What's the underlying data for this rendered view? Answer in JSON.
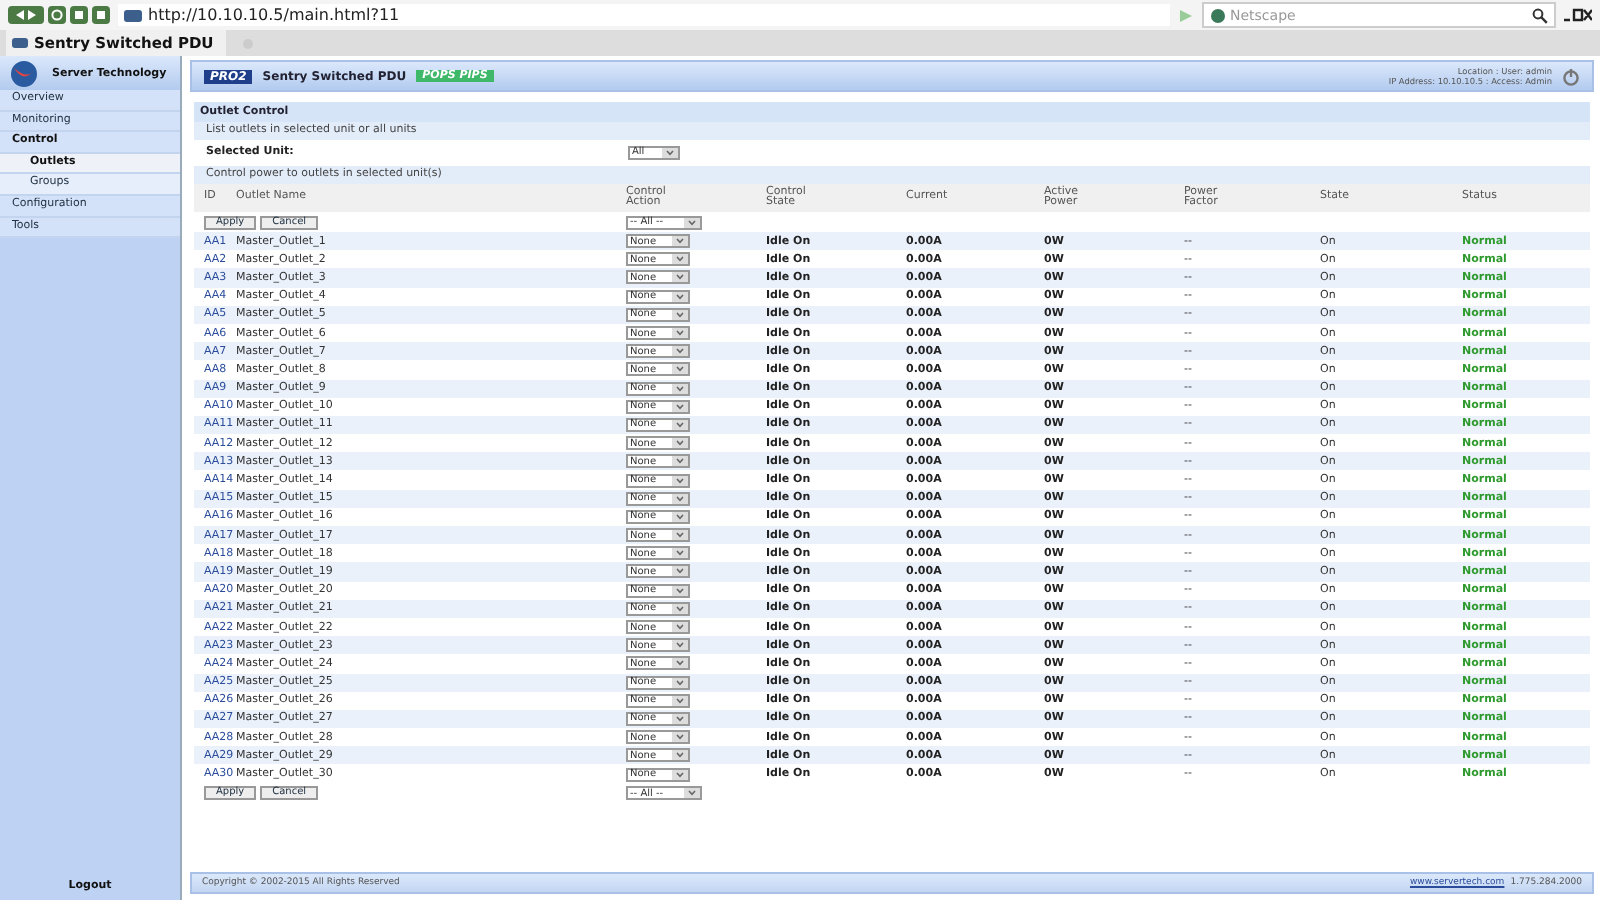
{
  "browser": {
    "url": "http://10.10.10.5/main.html?11",
    "search_placeholder": "Netscape",
    "tab_title": "Sentry Switched PDU"
  },
  "sidebar": {
    "brand": "Server Technology",
    "items": [
      {
        "label": "Overview",
        "selected": false
      },
      {
        "label": "Monitoring",
        "selected": false
      },
      {
        "label": "Control",
        "selected": false,
        "children": [
          {
            "label": "Outlets",
            "selected": true
          },
          {
            "label": "Groups",
            "selected": false
          }
        ]
      },
      {
        "label": "Configuration",
        "selected": false
      },
      {
        "label": "Tools",
        "selected": false
      }
    ],
    "logout": "Logout"
  },
  "header": {
    "badge": "PRO2",
    "title": "Sentry Switched PDU",
    "tag": "POPS PIPS",
    "info_line_1": "Location  :  User: admin",
    "info_line_2": "IP Address: 10.10.10.5  :  Access: Admin"
  },
  "section": {
    "title": "Outlet Control",
    "subtitle": "List outlets in selected unit or all units",
    "unit_label": "Selected Unit:",
    "unit_value": "All",
    "control_title": "Control power to outlets in selected unit(s)"
  },
  "columns": [
    "ID",
    "Outlet Name",
    "Control Action",
    "Control State",
    "Current",
    "Active Power",
    "Power Factor",
    "State",
    "Status"
  ],
  "top_actions": {
    "apply": "Apply",
    "cancel": "Cancel",
    "all_action": "-- All --"
  },
  "bottom_actions": {
    "apply": "Apply",
    "cancel": "Cancel",
    "all_action": "-- All --"
  },
  "rows": [
    {
      "id": "AA1",
      "name": "Master_Outlet_1",
      "action": "None",
      "control_state": "Idle On",
      "current": "0.00A",
      "power": "0W",
      "factor": "--",
      "state": "On",
      "status": "Normal"
    },
    {
      "id": "AA2",
      "name": "Master_Outlet_2",
      "action": "None",
      "control_state": "Idle On",
      "current": "0.00A",
      "power": "0W",
      "factor": "--",
      "state": "On",
      "status": "Normal"
    },
    {
      "id": "AA3",
      "name": "Master_Outlet_3",
      "action": "None",
      "control_state": "Idle On",
      "current": "0.00A",
      "power": "0W",
      "factor": "--",
      "state": "On",
      "status": "Normal"
    },
    {
      "id": "AA4",
      "name": "Master_Outlet_4",
      "action": "None",
      "control_state": "Idle On",
      "current": "0.00A",
      "power": "0W",
      "factor": "--",
      "state": "On",
      "status": "Normal"
    },
    {
      "id": "AA5",
      "name": "Master_Outlet_5",
      "action": "None",
      "control_state": "Idle On",
      "current": "0.00A",
      "power": "0W",
      "factor": "--",
      "state": "On",
      "status": "Normal"
    },
    {
      "id": "AA6",
      "name": "Master_Outlet_6",
      "action": "None",
      "control_state": "Idle On",
      "current": "0.00A",
      "power": "0W",
      "factor": "--",
      "state": "On",
      "status": "Normal"
    },
    {
      "id": "AA7",
      "name": "Master_Outlet_7",
      "action": "None",
      "control_state": "Idle On",
      "current": "0.00A",
      "power": "0W",
      "factor": "--",
      "state": "On",
      "status": "Normal"
    },
    {
      "id": "AA8",
      "name": "Master_Outlet_8",
      "action": "None",
      "control_state": "Idle On",
      "current": "0.00A",
      "power": "0W",
      "factor": "--",
      "state": "On",
      "status": "Normal"
    },
    {
      "id": "AA9",
      "name": "Master_Outlet_9",
      "action": "None",
      "control_state": "Idle On",
      "current": "0.00A",
      "power": "0W",
      "factor": "--",
      "state": "On",
      "status": "Normal"
    },
    {
      "id": "AA10",
      "name": "Master_Outlet_10",
      "action": "None",
      "control_state": "Idle On",
      "current": "0.00A",
      "power": "0W",
      "factor": "--",
      "state": "On",
      "status": "Normal"
    },
    {
      "id": "AA11",
      "name": "Master_Outlet_11",
      "action": "None",
      "control_state": "Idle On",
      "current": "0.00A",
      "power": "0W",
      "factor": "--",
      "state": "On",
      "status": "Normal"
    },
    {
      "id": "AA12",
      "name": "Master_Outlet_12",
      "action": "None",
      "control_state": "Idle On",
      "current": "0.00A",
      "power": "0W",
      "factor": "--",
      "state": "On",
      "status": "Normal"
    },
    {
      "id": "AA13",
      "name": "Master_Outlet_13",
      "action": "None",
      "control_state": "Idle On",
      "current": "0.00A",
      "power": "0W",
      "factor": "--",
      "state": "On",
      "status": "Normal"
    },
    {
      "id": "AA14",
      "name": "Master_Outlet_14",
      "action": "None",
      "control_state": "Idle On",
      "current": "0.00A",
      "power": "0W",
      "factor": "--",
      "state": "On",
      "status": "Normal"
    },
    {
      "id": "AA15",
      "name": "Master_Outlet_15",
      "action": "None",
      "control_state": "Idle On",
      "current": "0.00A",
      "power": "0W",
      "factor": "--",
      "state": "On",
      "status": "Normal"
    },
    {
      "id": "AA16",
      "name": "Master_Outlet_16",
      "action": "None",
      "control_state": "Idle On",
      "current": "0.00A",
      "power": "0W",
      "factor": "--",
      "state": "On",
      "status": "Normal"
    },
    {
      "id": "AA17",
      "name": "Master_Outlet_17",
      "action": "None",
      "control_state": "Idle On",
      "current": "0.00A",
      "power": "0W",
      "factor": "--",
      "state": "On",
      "status": "Normal"
    },
    {
      "id": "AA18",
      "name": "Master_Outlet_18",
      "action": "None",
      "control_state": "Idle On",
      "current": "0.00A",
      "power": "0W",
      "factor": "--",
      "state": "On",
      "status": "Normal"
    },
    {
      "id": "AA19",
      "name": "Master_Outlet_19",
      "action": "None",
      "control_state": "Idle On",
      "current": "0.00A",
      "power": "0W",
      "factor": "--",
      "state": "On",
      "status": "Normal"
    },
    {
      "id": "AA20",
      "name": "Master_Outlet_20",
      "action": "None",
      "control_state": "Idle On",
      "current": "0.00A",
      "power": "0W",
      "factor": "--",
      "state": "On",
      "status": "Normal"
    },
    {
      "id": "AA21",
      "name": "Master_Outlet_21",
      "action": "None",
      "control_state": "Idle On",
      "current": "0.00A",
      "power": "0W",
      "factor": "--",
      "state": "On",
      "status": "Normal"
    },
    {
      "id": "AA22",
      "name": "Master_Outlet_22",
      "action": "None",
      "control_state": "Idle On",
      "current": "0.00A",
      "power": "0W",
      "factor": "--",
      "state": "On",
      "status": "Normal"
    },
    {
      "id": "AA23",
      "name": "Master_Outlet_23",
      "action": "None",
      "control_state": "Idle On",
      "current": "0.00A",
      "power": "0W",
      "factor": "--",
      "state": "On",
      "status": "Normal"
    },
    {
      "id": "AA24",
      "name": "Master_Outlet_24",
      "action": "None",
      "control_state": "Idle On",
      "current": "0.00A",
      "power": "0W",
      "factor": "--",
      "state": "On",
      "status": "Normal"
    },
    {
      "id": "AA25",
      "name": "Master_Outlet_25",
      "action": "None",
      "control_state": "Idle On",
      "current": "0.00A",
      "power": "0W",
      "factor": "--",
      "state": "On",
      "status": "Normal"
    },
    {
      "id": "AA26",
      "name": "Master_Outlet_26",
      "action": "None",
      "control_state": "Idle On",
      "current": "0.00A",
      "power": "0W",
      "factor": "--",
      "state": "On",
      "status": "Normal"
    },
    {
      "id": "AA27",
      "name": "Master_Outlet_27",
      "action": "None",
      "control_state": "Idle On",
      "current": "0.00A",
      "power": "0W",
      "factor": "--",
      "state": "On",
      "status": "Normal"
    },
    {
      "id": "AA28",
      "name": "Master_Outlet_28",
      "action": "None",
      "control_state": "Idle On",
      "current": "0.00A",
      "power": "0W",
      "factor": "--",
      "state": "On",
      "status": "Normal"
    },
    {
      "id": "AA29",
      "name": "Master_Outlet_29",
      "action": "None",
      "control_state": "Idle On",
      "current": "0.00A",
      "power": "0W",
      "factor": "--",
      "state": "On",
      "status": "Normal"
    },
    {
      "id": "AA30",
      "name": "Master_Outlet_30",
      "action": "None",
      "control_state": "Idle On",
      "current": "0.00A",
      "power": "0W",
      "factor": "--",
      "state": "On",
      "status": "Normal"
    }
  ],
  "footer": {
    "copyright": "Copyright © 2002-2015 All Rights Reserved",
    "link": "www.servertech.com",
    "phone": "1.775.284.2000"
  }
}
